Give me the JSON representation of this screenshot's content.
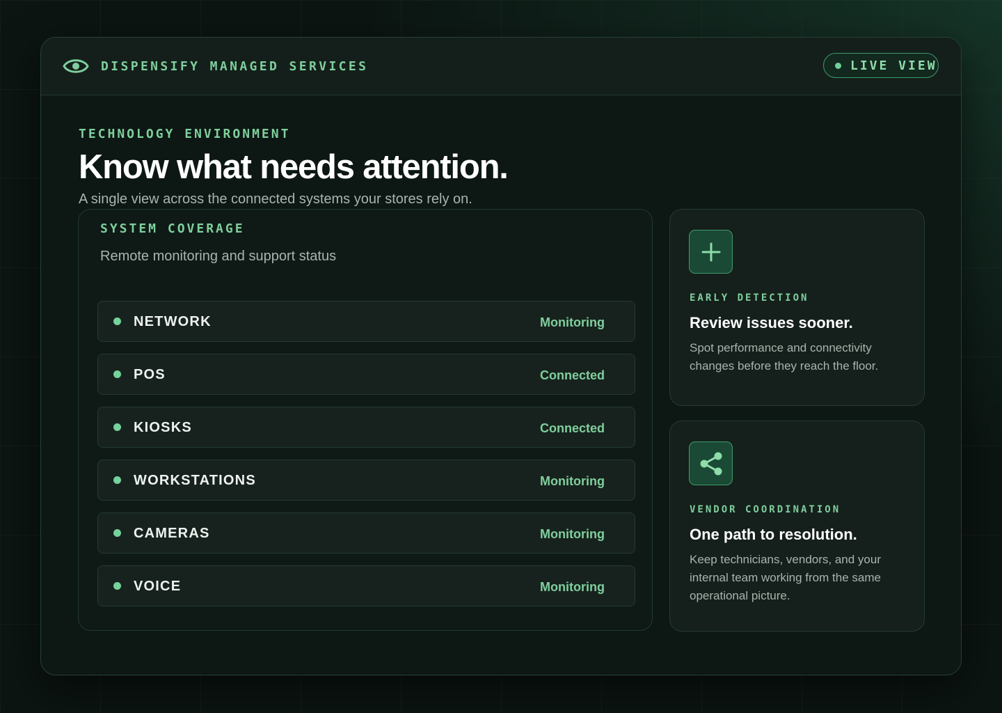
{
  "header": {
    "brand": "DISPENSIFY MANAGED SERVICES",
    "brand_icon": "eye-icon",
    "live_label": "LIVE VIEW"
  },
  "hero": {
    "eyebrow": "TECHNOLOGY ENVIRONMENT",
    "headline": "Know what needs attention.",
    "subtitle": "A single view across the connected systems your stores rely on."
  },
  "coverage": {
    "title": "SYSTEM COVERAGE",
    "subtitle": "Remote monitoring and support status",
    "systems": [
      {
        "name": "NETWORK",
        "status": "Monitoring"
      },
      {
        "name": "POS",
        "status": "Connected"
      },
      {
        "name": "KIOSKS",
        "status": "Connected"
      },
      {
        "name": "WORKSTATIONS",
        "status": "Monitoring"
      },
      {
        "name": "CAMERAS",
        "status": "Monitoring"
      },
      {
        "name": "VOICE",
        "status": "Monitoring"
      }
    ]
  },
  "cards": [
    {
      "icon": "plus-icon",
      "eyebrow": "EARLY DETECTION",
      "title": "Review issues sooner.",
      "body": "Spot performance and connectivity changes before they reach the floor."
    },
    {
      "icon": "share-icon",
      "eyebrow": "VENDOR COORDINATION",
      "title": "One path to resolution.",
      "body": "Keep technicians, vendors, and your internal team working from the same operational picture."
    }
  ],
  "colors": {
    "accent": "#7fcf9d",
    "background": "#0c1512",
    "panel": "#151f1b",
    "status_dot": "#74d39b"
  }
}
